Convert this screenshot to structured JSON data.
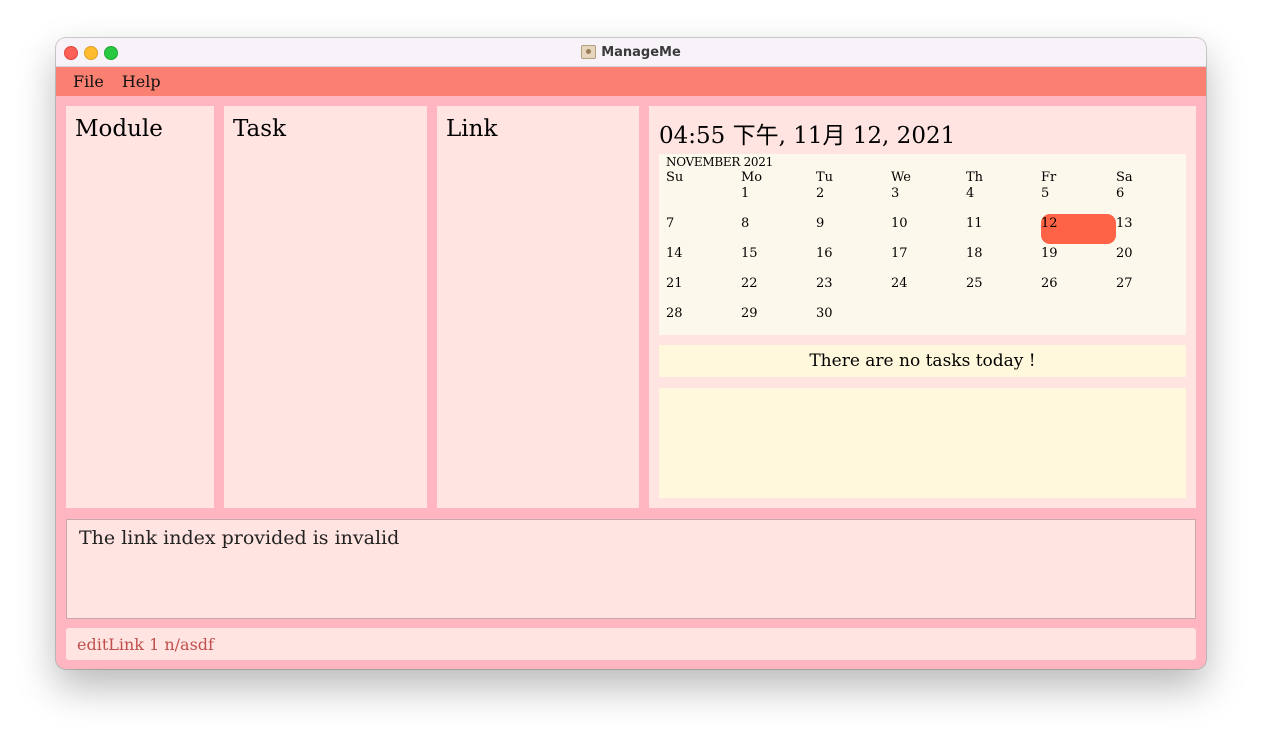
{
  "window": {
    "title": "ManageMe"
  },
  "menu": {
    "file": "File",
    "help": "Help"
  },
  "panels": {
    "module": "Module",
    "task": "Task",
    "link": "Link"
  },
  "clock": "04:55 下午, 11月 12, 2021",
  "calendar": {
    "month_label": "NOVEMBER 2021",
    "weekdays": [
      "Su",
      "Mo",
      "Tu",
      "We",
      "Th",
      "Fr",
      "Sa"
    ],
    "first_weekday_index": 1,
    "days_in_month": 30,
    "today": 12,
    "today_color": "#ff6347"
  },
  "tasks_today": "There are no tasks today !",
  "result": "The link index provided is invalid",
  "command": {
    "value": "editLink 1 n/asdf"
  },
  "colors": {
    "menu_bg": "#fa8072",
    "window_bg": "#ffb6c1",
    "panel_bg": "#ffe4e1",
    "calendar_bg": "#fdf8ec",
    "task_bg": "#fff8dc",
    "command_text": "#c0504d"
  }
}
